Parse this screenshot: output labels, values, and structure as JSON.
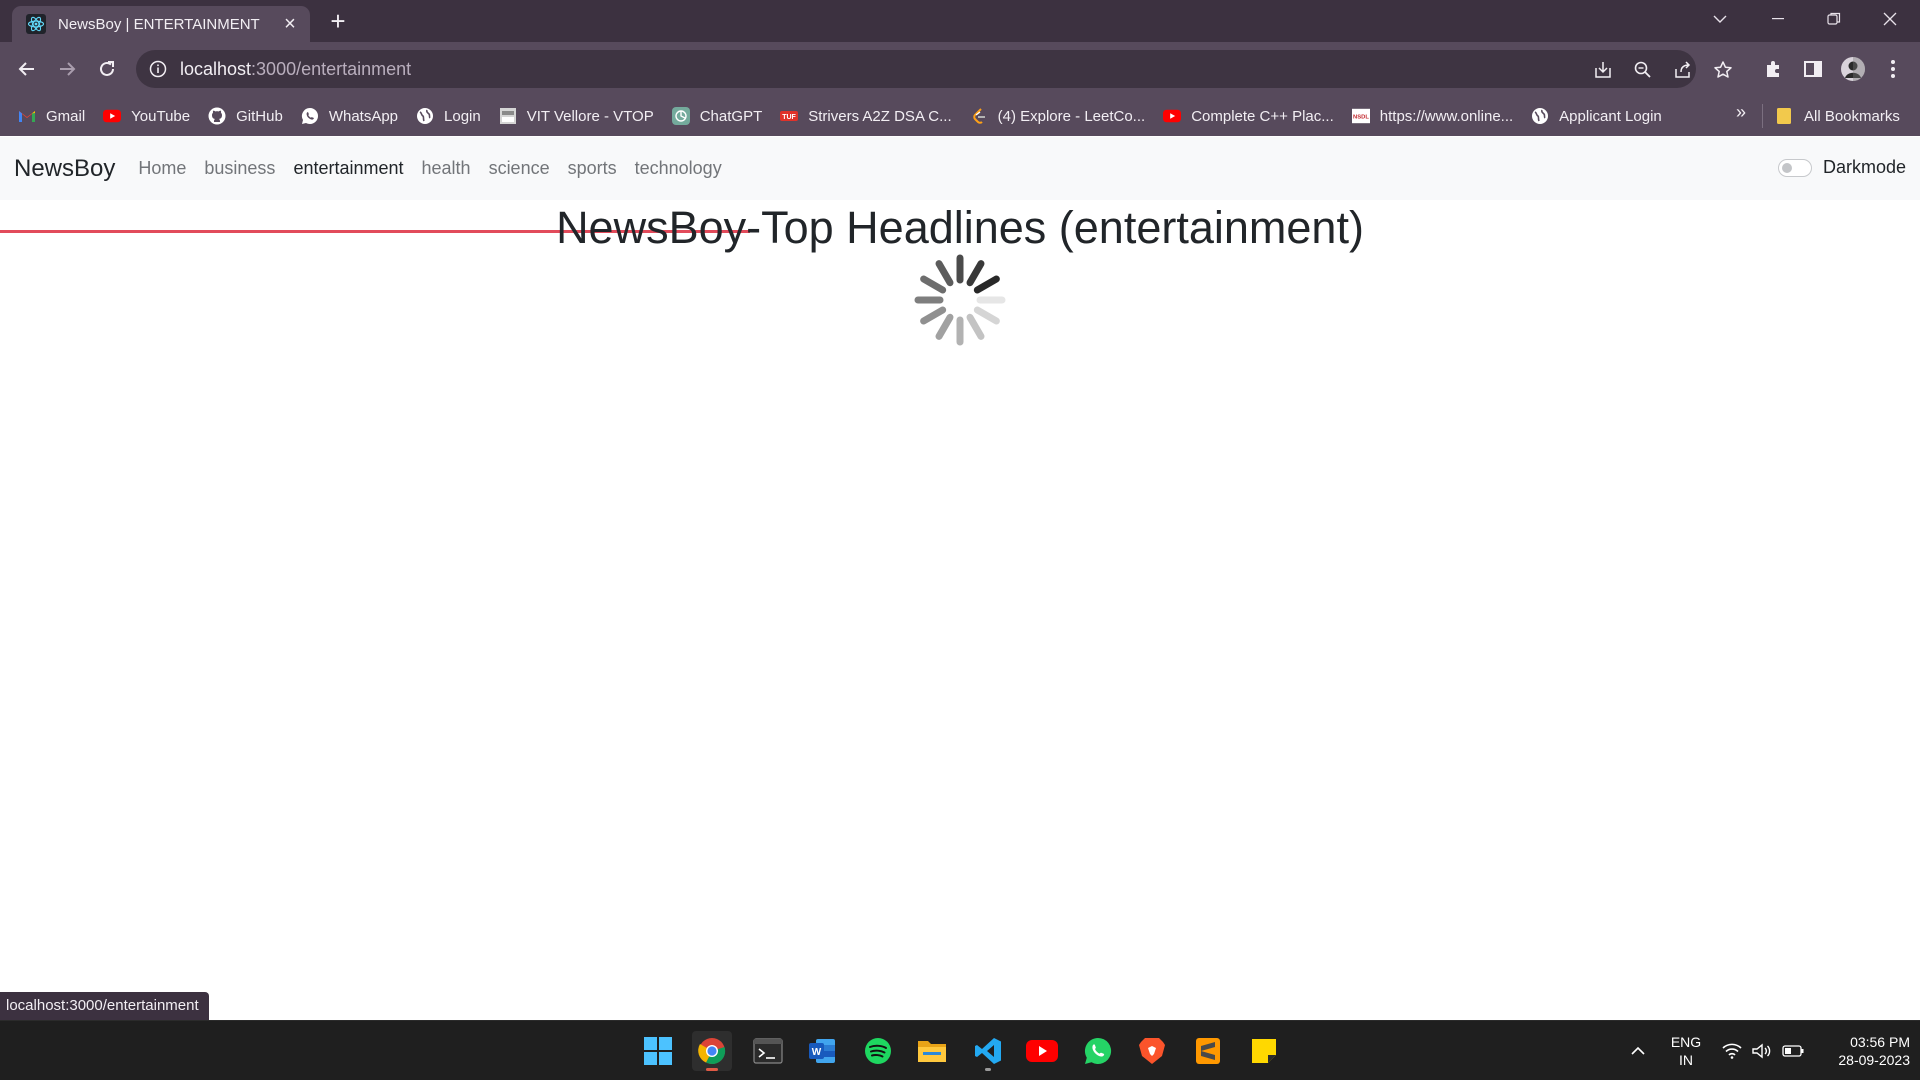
{
  "browser": {
    "tab_title": "NewsBoy | ENTERTAINMENT",
    "url_host": "localhost",
    "url_path": ":3000/entertainment",
    "bookmarks": [
      {
        "label": "Gmail",
        "icon": "gmail-icon",
        "color": "#ea4335"
      },
      {
        "label": "YouTube",
        "icon": "youtube-icon",
        "color": "#ff0000"
      },
      {
        "label": "GitHub",
        "icon": "github-icon",
        "color": "#ffffff"
      },
      {
        "label": "WhatsApp",
        "icon": "whatsapp-icon",
        "color": "#ffffff"
      },
      {
        "label": "Login",
        "icon": "globe-icon",
        "color": "#ffffff"
      },
      {
        "label": "VIT Vellore - VTOP",
        "icon": "vtop-icon",
        "color": "#cccccc"
      },
      {
        "label": "ChatGPT",
        "icon": "chatgpt-icon",
        "color": "#74aa9c"
      },
      {
        "label": "Strivers A2Z DSA C...",
        "icon": "tuf-icon",
        "color": "#e0322a"
      },
      {
        "label": "(4) Explore - LeetCo...",
        "icon": "leetcode-icon",
        "color": "#ffa116"
      },
      {
        "label": "Complete C++ Plac...",
        "icon": "youtube-icon",
        "color": "#ff0000"
      },
      {
        "label": "https://www.online...",
        "icon": "nsdl-icon",
        "color": "#ffffff"
      },
      {
        "label": "Applicant Login",
        "icon": "globe-icon",
        "color": "#ffffff"
      }
    ],
    "more_bookmarks": "»",
    "all_bookmarks": "All Bookmarks",
    "status_url": "localhost:3000/entertainment"
  },
  "app": {
    "brand": "NewsBoy",
    "nav": [
      {
        "label": "Home",
        "active": false
      },
      {
        "label": "business",
        "active": false
      },
      {
        "label": "entertainment",
        "active": true
      },
      {
        "label": "health",
        "active": false
      },
      {
        "label": "science",
        "active": false
      },
      {
        "label": "sports",
        "active": false
      },
      {
        "label": "technology",
        "active": false
      }
    ],
    "darkmode_label": "Darkmode",
    "darkmode_on": false,
    "headline": "NewsBoy-Top Headlines (entertainment)",
    "loading": true
  },
  "taskbar": {
    "apps": [
      "windows-start-icon",
      "chrome-icon",
      "terminal-icon",
      "word-icon",
      "spotify-icon",
      "file-explorer-icon",
      "vscode-icon",
      "youtube-icon",
      "whatsapp-icon",
      "brave-icon",
      "sublime-text-icon",
      "sticky-notes-icon"
    ],
    "lang_line1": "ENG",
    "lang_line2": "IN",
    "time": "03:56 PM",
    "date": "28-09-2023"
  },
  "colors": {
    "chrome_frame": "#3c3140",
    "chrome_toolbar": "#574a5c",
    "navbar_bg": "#f8f9fa",
    "loading_bar": "#e24b5b"
  }
}
